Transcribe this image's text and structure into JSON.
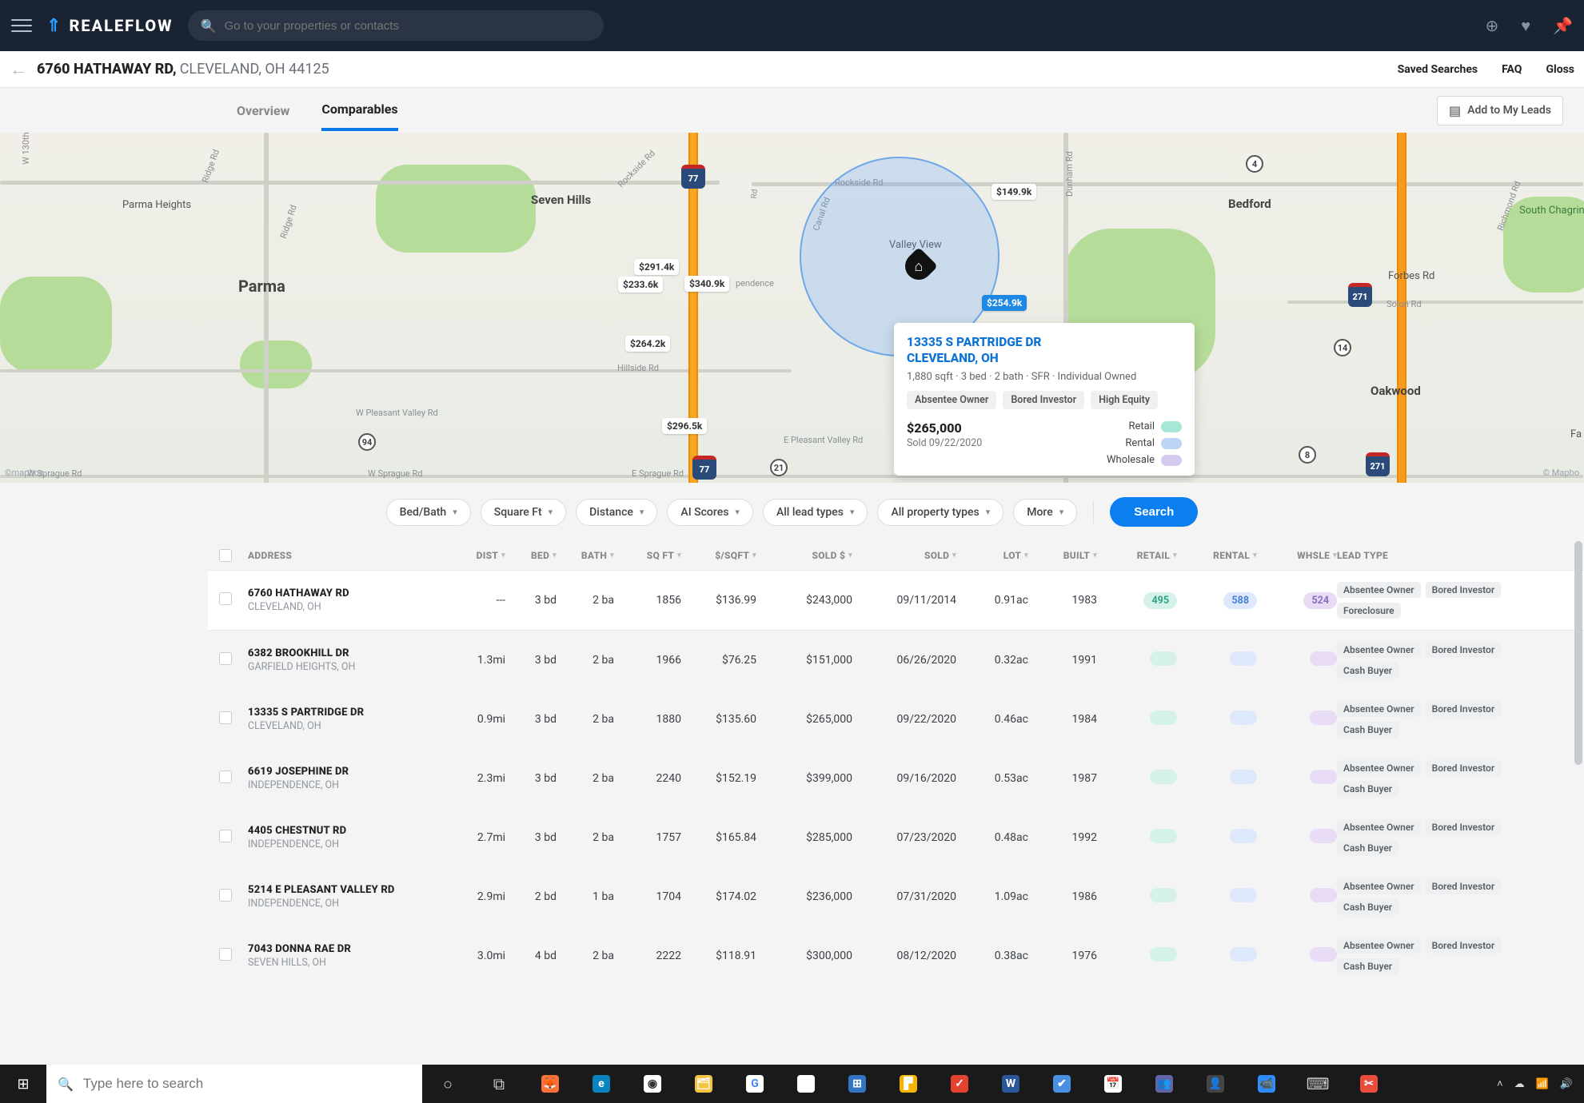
{
  "topbar": {
    "brand": "REALEFLOW",
    "search_placeholder": "Go to your properties or contacts"
  },
  "subheader": {
    "address_line1": "6760 HATHAWAY RD,",
    "address_line2": "CLEVELAND, OH 44125",
    "links": {
      "saved": "Saved Searches",
      "faq": "FAQ",
      "glossary": "Gloss"
    }
  },
  "tabs": {
    "overview": "Overview",
    "comparables": "Comparables",
    "add_leads": "Add to My Leads"
  },
  "map": {
    "labels": {
      "parma_heights": "Parma Heights",
      "parma": "Parma",
      "seven_hills": "Seven Hills",
      "valley_view": "Valley View",
      "bedford": "Bedford",
      "oakwood": "Oakwood",
      "forbes": "Forbes Rd",
      "south_chagrin": "South Chagrin Reservation",
      "fa": "Fa",
      "credit_left": "©mapbox",
      "credit_right": "© Mapbo"
    },
    "roads": {
      "w130th": "W 130th",
      "ridge": "Ridge Rd",
      "ridge2": "Ridge Rd",
      "rockside": "Rockside Rd",
      "rockside2": "Rockside Rd",
      "canal": "Canal Rd",
      "dunham": "Dunham Rd",
      "richmond": "Richmond Rd",
      "hillside": "Hillside Rd",
      "w_pleasant": "W Pleasant Valley Rd",
      "e_pleasant": "E Pleasant Valley Rd",
      "w_sprague": "W Sprague Rd",
      "e_sprague": "E Sprague Rd",
      "solon": "Solon Rd",
      "prospect": "pendence"
    },
    "routes": {
      "r77a": "77",
      "r77b": "77",
      "r94": "94",
      "r21": "21",
      "r4": "4",
      "r8": "8",
      "r14": "14",
      "r271a": "271",
      "r271b": "271"
    },
    "pins": {
      "p1": "$291.4k",
      "p2": "$233.6k",
      "p3": "$340.9k",
      "p4": "$264.2k",
      "p5": "$296.5k",
      "p6": "$149.9k",
      "p7": "$254.9k"
    },
    "popup": {
      "title_l1": "13335 S PARTRIDGE DR",
      "title_l2": "CLEVELAND, OH",
      "meta": "1,880 sqft · 3 bed · 2 bath · SFR · Individual Owned",
      "tags": {
        "t1": "Absentee Owner",
        "t2": "Bored Investor",
        "t3": "High Equity"
      },
      "price": "$265,000",
      "sold": "Sold 09/22/2020",
      "scores": {
        "retail": "Retail",
        "rental": "Rental",
        "wholesale": "Wholesale"
      }
    }
  },
  "filters": {
    "bedbath": "Bed/Bath",
    "sqft": "Square Ft",
    "distance": "Distance",
    "ai": "AI Scores",
    "lead": "All lead types",
    "prop": "All property types",
    "more": "More",
    "search": "Search"
  },
  "columns": {
    "address": "ADDRESS",
    "dist": "DIST",
    "bed": "BED",
    "bath": "BATH",
    "sqft": "SQ FT",
    "psqft": "$/SQFT",
    "sold_price": "SOLD $",
    "sold": "SOLD",
    "lot": "LOT",
    "built": "BUILT",
    "retail": "RETAIL",
    "rental": "RENTAL",
    "whsle": "WHSLE",
    "leadtype": "LEAD TYPE"
  },
  "rows": [
    {
      "a1": "6760 HATHAWAY RD",
      "a2": "CLEVELAND, OH",
      "dist": "---",
      "bed": "3 bd",
      "bath": "2 ba",
      "sqft": "1856",
      "psqft": "$136.99",
      "sold_price": "$243,000",
      "sold": "09/11/2014",
      "lot": "0.91ac",
      "built": "1983",
      "retail": "495",
      "rental": "588",
      "whsle": "524",
      "tags": [
        "Absentee Owner",
        "Bored Investor",
        "Foreclosure"
      ],
      "subject": true
    },
    {
      "a1": "6382 BROOKHILL DR",
      "a2": "GARFIELD HEIGHTS, OH",
      "dist": "1.3mi",
      "bed": "3 bd",
      "bath": "2 ba",
      "sqft": "1966",
      "psqft": "$76.25",
      "sold_price": "$151,000",
      "sold": "06/26/2020",
      "lot": "0.32ac",
      "built": "1991",
      "tags": [
        "Absentee Owner",
        "Bored Investor",
        "Cash Buyer"
      ]
    },
    {
      "a1": "13335 S PARTRIDGE DR",
      "a2": "CLEVELAND, OH",
      "dist": "0.9mi",
      "bed": "3 bd",
      "bath": "2 ba",
      "sqft": "1880",
      "psqft": "$135.60",
      "sold_price": "$265,000",
      "sold": "09/22/2020",
      "lot": "0.46ac",
      "built": "1984",
      "tags": [
        "Absentee Owner",
        "Bored Investor",
        "Cash Buyer"
      ]
    },
    {
      "a1": "6619 JOSEPHINE DR",
      "a2": "INDEPENDENCE, OH",
      "dist": "2.3mi",
      "bed": "3 bd",
      "bath": "2 ba",
      "sqft": "2240",
      "psqft": "$152.19",
      "sold_price": "$399,000",
      "sold": "09/16/2020",
      "lot": "0.53ac",
      "built": "1987",
      "tags": [
        "Absentee Owner",
        "Bored Investor",
        "Cash Buyer"
      ]
    },
    {
      "a1": "4405 CHESTNUT RD",
      "a2": "INDEPENDENCE, OH",
      "dist": "2.7mi",
      "bed": "3 bd",
      "bath": "2 ba",
      "sqft": "1757",
      "psqft": "$165.84",
      "sold_price": "$285,000",
      "sold": "07/23/2020",
      "lot": "0.48ac",
      "built": "1992",
      "tags": [
        "Absentee Owner",
        "Bored Investor",
        "Cash Buyer"
      ]
    },
    {
      "a1": "5214 E PLEASANT VALLEY RD",
      "a2": "INDEPENDENCE, OH",
      "dist": "2.9mi",
      "bed": "2 bd",
      "bath": "1 ba",
      "sqft": "1704",
      "psqft": "$174.02",
      "sold_price": "$236,000",
      "sold": "07/31/2020",
      "lot": "1.09ac",
      "built": "1986",
      "tags": [
        "Absentee Owner",
        "Bored Investor",
        "Cash Buyer"
      ]
    },
    {
      "a1": "7043 DONNA RAE DR",
      "a2": "SEVEN HILLS, OH",
      "dist": "3.0mi",
      "bed": "4 bd",
      "bath": "2 ba",
      "sqft": "2222",
      "psqft": "$118.91",
      "sold_price": "$300,000",
      "sold": "08/12/2020",
      "lot": "0.38ac",
      "built": "1976",
      "tags": [
        "Absentee Owner",
        "Bored Investor",
        "Cash Buyer"
      ]
    }
  ],
  "taskbar": {
    "search_placeholder": "Type here to search"
  }
}
